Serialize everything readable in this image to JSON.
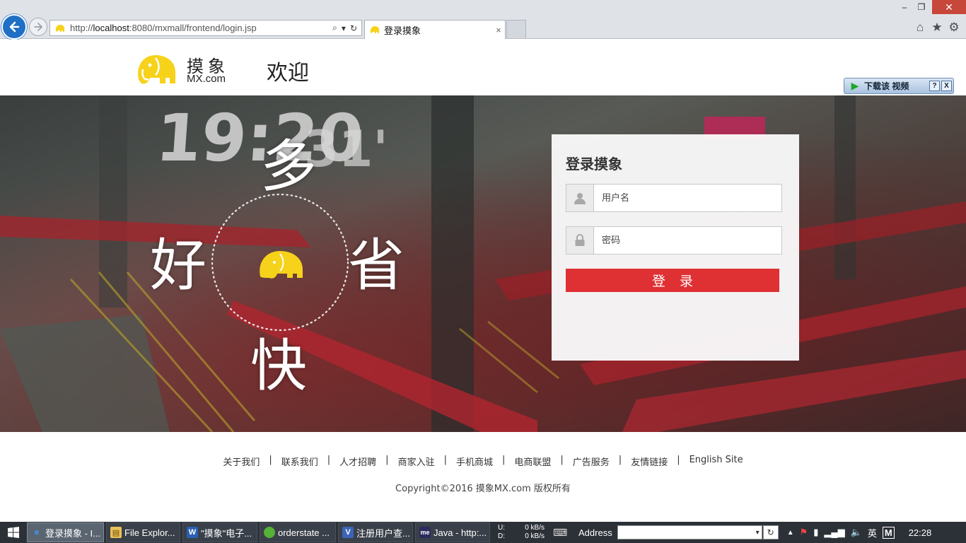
{
  "browser": {
    "url_prefix": "http://",
    "url_host": "localhost",
    "url_rest": ":8080/mxmall/frontend/login.jsp",
    "tab_title": "登录摸象",
    "tab_close": "×",
    "win_min": "‒",
    "win_max": "❐",
    "win_close": "✕"
  },
  "header": {
    "logo_name": "摸象",
    "logo_domain": "MX.com",
    "welcome": "欢迎"
  },
  "download_widget": {
    "label": "下载该 视频",
    "help": "?",
    "close": "X"
  },
  "banner": {
    "slogans": [
      "多",
      "好",
      "省",
      "快"
    ]
  },
  "login": {
    "title": "登录摸象",
    "username_placeholder": "用户名",
    "password_placeholder": "密码",
    "submit_label": "登录"
  },
  "footer": {
    "links": [
      "关于我们",
      "联系我们",
      "人才招聘",
      "商家入驻",
      "手机商城",
      "电商联盟",
      "广告服务",
      "友情链接",
      "English Site"
    ],
    "separator": "|",
    "copyright": "Copyright©2016 摸象MX.com 版权所有"
  },
  "taskbar": {
    "items": [
      {
        "label": "登录摸象 - I...",
        "icon": "ie-icon",
        "active": true
      },
      {
        "label": "File Explor...",
        "icon": "folder-icon",
        "active": false
      },
      {
        "label": "\"摸象\"电子...",
        "icon": "word-icon",
        "active": false
      },
      {
        "label": "orderstate ...",
        "icon": "app-icon",
        "active": false
      },
      {
        "label": "注册用户查...",
        "icon": "visio-icon",
        "active": false
      },
      {
        "label": "Java - http:...",
        "icon": "eclipse-icon",
        "active": false
      }
    ],
    "upload_label": "U:",
    "upload_value": "0 kB/s",
    "download_label": "D:",
    "download_value": "0 kB/s",
    "address_label": "Address",
    "ime": "英",
    "clock": "22:28"
  },
  "colors": {
    "accent_red": "#df3033",
    "logo_yellow": "#f6d21a",
    "taskbar": "#2c3138"
  }
}
